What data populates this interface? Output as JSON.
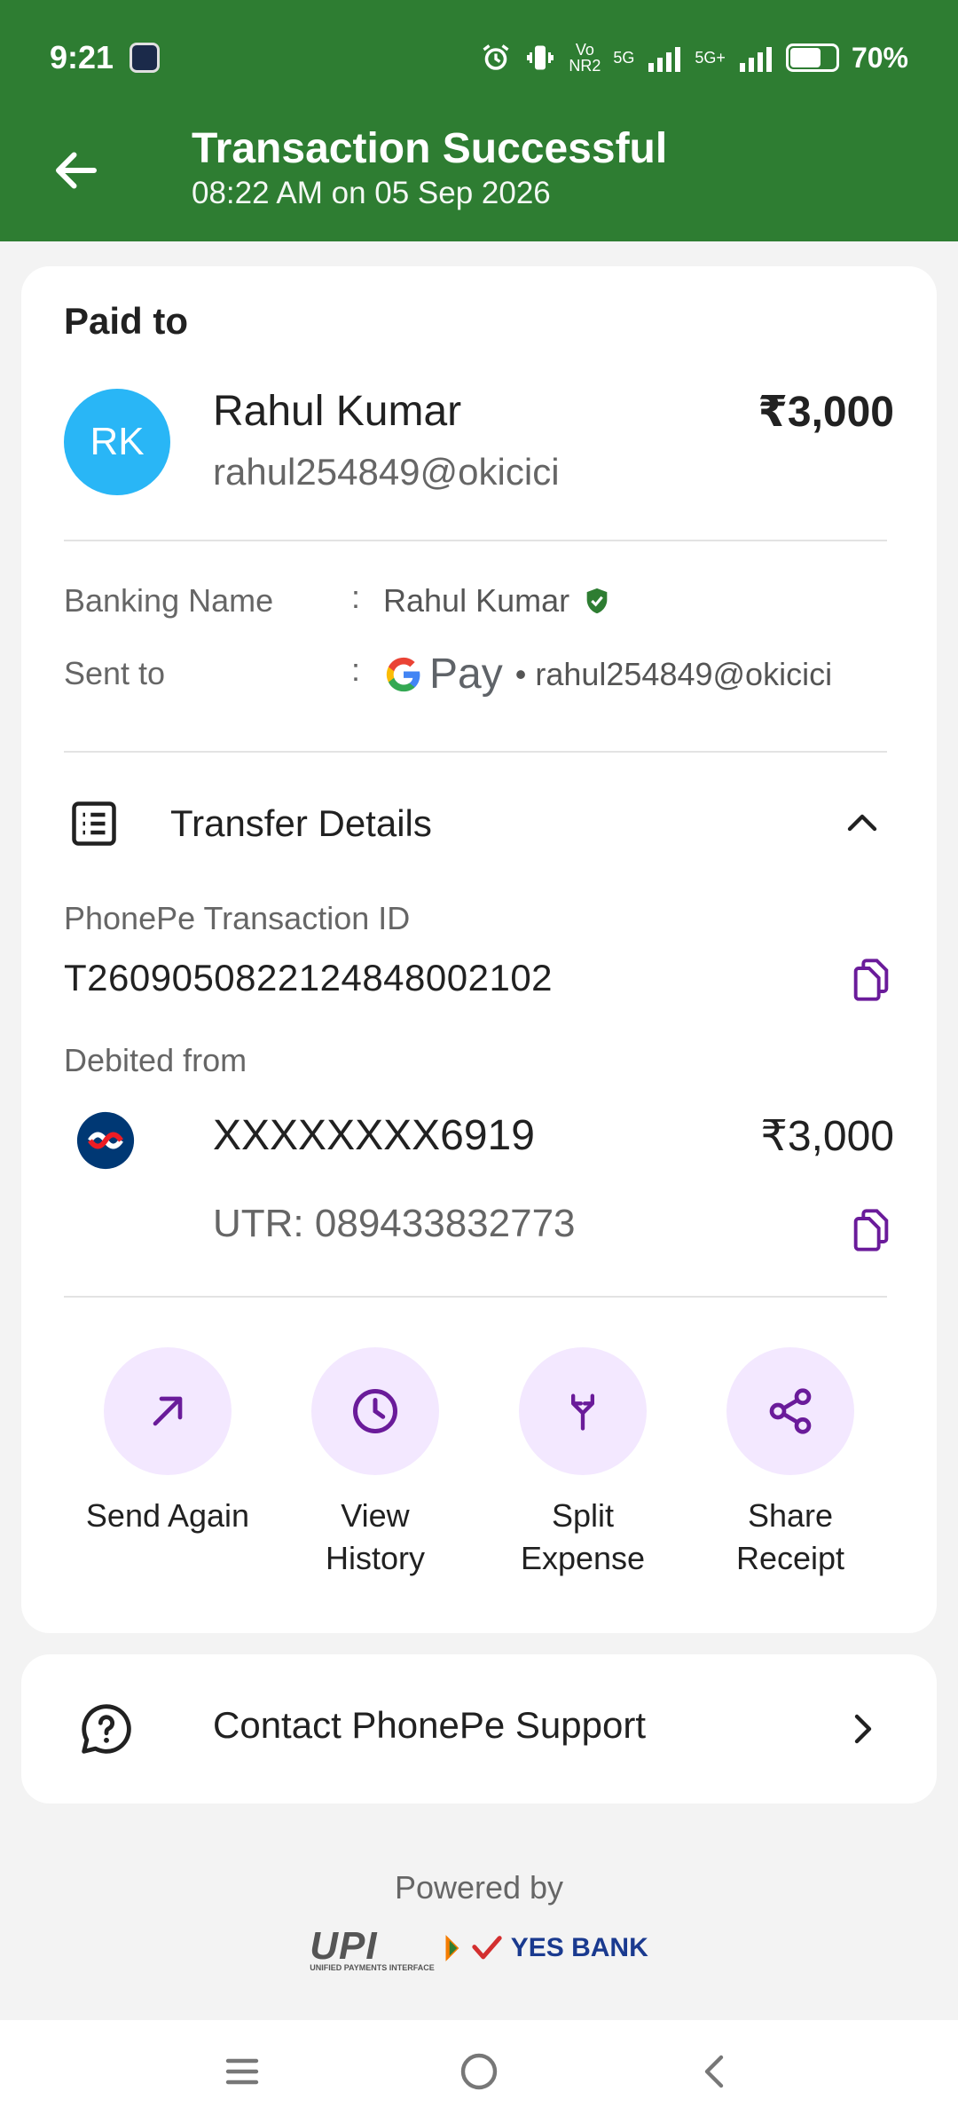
{
  "status_bar": {
    "time": "9:21",
    "battery": "70%",
    "battery_level": 0.7,
    "network_labels": [
      "Vo",
      "NR2",
      "5G",
      "5G+"
    ]
  },
  "header": {
    "title": "Transaction Successful",
    "subtitle": "08:22 AM on 05 Sep 2026"
  },
  "payment": {
    "paid_to_label": "Paid to",
    "avatar_initials": "RK",
    "payee_name": "Rahul Kumar",
    "payee_vpa": "rahul254849@okicici",
    "amount": "₹3,000"
  },
  "details": {
    "banking_name_label": "Banking Name",
    "banking_name_value": "Rahul Kumar",
    "sent_to_label": "Sent to",
    "sent_to_app": "Pay",
    "sent_to_vpa": "• rahul254849@okicici",
    "colon": ":"
  },
  "transfer": {
    "section_title": "Transfer Details",
    "txn_id_label": "PhonePe Transaction ID",
    "txn_id": "T2609050822124848002102",
    "debited_label": "Debited from",
    "account": "XXXXXXXX6919",
    "debit_amount": "₹3,000",
    "utr": "UTR: 089433832773"
  },
  "actions": [
    {
      "line1": "Send Again",
      "line2": ""
    },
    {
      "line1": "View",
      "line2": "History"
    },
    {
      "line1": "Split",
      "line2": "Expense"
    },
    {
      "line1": "Share",
      "line2": "Receipt"
    }
  ],
  "support": {
    "label": "Contact PhonePe Support"
  },
  "footer": {
    "powered_by": "Powered by",
    "upi": "UPI",
    "upi_sub": "UNIFIED PAYMENTS INTERFACE",
    "bank": "YES BANK"
  },
  "colors": {
    "header_green": "#2e7d32",
    "accent_purple": "#6a1b9a",
    "avatar_blue": "#29b6f6",
    "action_bg": "#f3e8ff",
    "verified_green": "#2e7d32"
  }
}
